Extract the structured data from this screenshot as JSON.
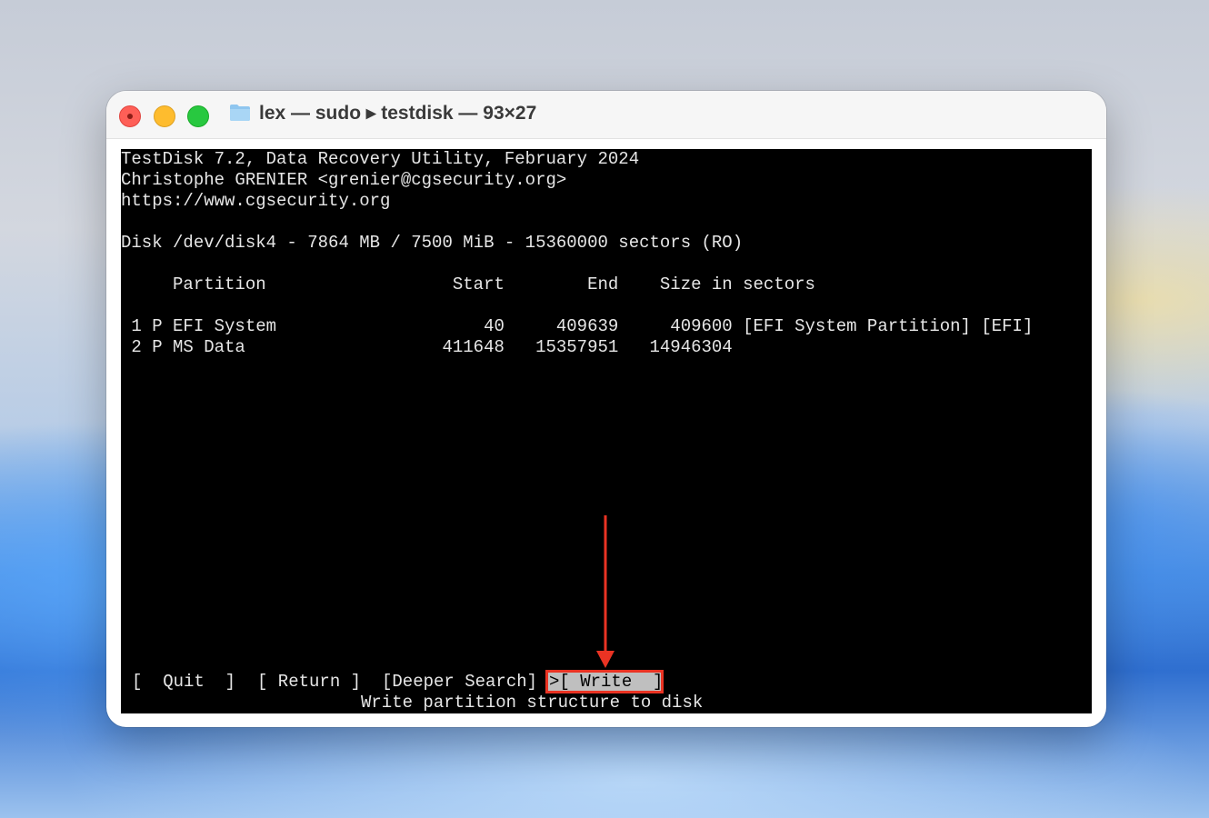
{
  "window": {
    "title": "lex — sudo ▸ testdisk — 93×27"
  },
  "terminal": {
    "header_line1": "TestDisk 7.2, Data Recovery Utility, February 2024",
    "header_line2": "Christophe GRENIER <grenier@cgsecurity.org>",
    "header_line3": "https://www.cgsecurity.org",
    "disk_line": "Disk /dev/disk4 - 7864 MB / 7500 MiB - 15360000 sectors (RO)",
    "table_header": "     Partition                  Start        End    Size in sectors",
    "rows": [
      " 1 P EFI System                    40     409639     409600 [EFI System Partition] [EFI]",
      " 2 P MS Data                   411648   15357951   14946304"
    ],
    "menu": {
      "quit": "[  Quit  ]",
      "return": "[ Return ]",
      "deeper_search": "[Deeper Search]",
      "write": ">[ Write  ]"
    },
    "hint": "Write partition structure to disk"
  },
  "colors": {
    "highlight_border": "#ea3323",
    "arrow": "#ea3323",
    "selected_bg": "#bfbfbf"
  }
}
